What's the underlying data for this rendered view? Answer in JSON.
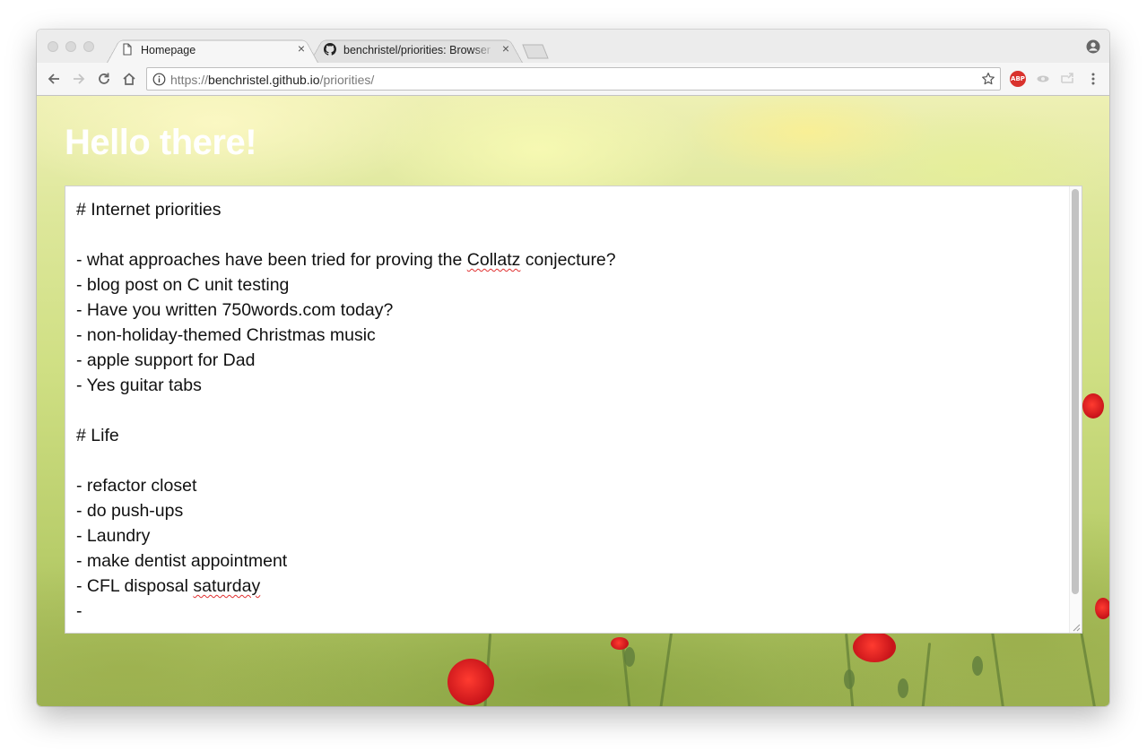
{
  "browser": {
    "tabs": [
      {
        "title": "Homepage",
        "icon": "document-icon",
        "active": true
      },
      {
        "title": "benchristel/priorities: Browser",
        "icon": "github-icon",
        "active": false
      }
    ],
    "tab_close_glyph": "×",
    "address": {
      "scheme": "https://",
      "host": "benchristel.github.io",
      "path": "/priorities/"
    },
    "extensions": {
      "abp_label": "ABP"
    }
  },
  "page": {
    "title": "Hello there!",
    "editor": {
      "lines": [
        [
          {
            "t": "# Internet priorities"
          }
        ],
        [],
        [
          {
            "t": "- what approaches have been tried for proving the "
          },
          {
            "t": "Collatz",
            "spell": true
          },
          {
            "t": " conjecture?"
          }
        ],
        [
          {
            "t": "- blog post on C unit testing"
          }
        ],
        [
          {
            "t": "- Have you written 750words.com today?"
          }
        ],
        [
          {
            "t": "- non-holiday-themed Christmas music"
          }
        ],
        [
          {
            "t": "- apple support for Dad"
          }
        ],
        [
          {
            "t": "- Yes guitar tabs"
          }
        ],
        [],
        [
          {
            "t": "# Life"
          }
        ],
        [],
        [
          {
            "t": "- refactor closet"
          }
        ],
        [
          {
            "t": "- do push-ups"
          }
        ],
        [
          {
            "t": "- Laundry"
          }
        ],
        [
          {
            "t": "- make dentist appointment"
          }
        ],
        [
          {
            "t": "- CFL disposal "
          },
          {
            "t": "saturday",
            "spell": true
          }
        ],
        [
          {
            "t": "-"
          }
        ]
      ]
    }
  },
  "colors": {
    "spellcheck_underline": "#e03030",
    "title_text": "#ffffff",
    "background_meadow": "#cfdf83"
  }
}
